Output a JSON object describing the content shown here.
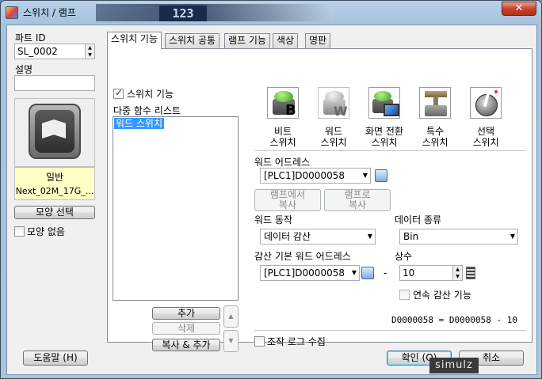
{
  "window": {
    "title": "스위치 / 램프",
    "close_glyph": "✕",
    "bg_number": "123"
  },
  "left": {
    "part_id_label": "파트 ID",
    "part_id_value": "SL_0002",
    "desc_label": "설명",
    "desc_value": "",
    "shape_name": "일반",
    "shape_file": "Next_02M_17G_...",
    "select_shape_btn": "모양 선택",
    "no_shape_label": "모양 없음",
    "no_shape_checked": false
  },
  "tabs": [
    "스위치 기능",
    "스위치 공통",
    "램프 기능",
    "색상",
    "명판"
  ],
  "switch_func": {
    "enable_label": "스위치 기능",
    "enable_checked": true,
    "multi_list_label": "다중 함수 리스트",
    "list_items": [
      "워드 스위치"
    ],
    "add_btn": "추가",
    "delete_btn": "삭제",
    "copy_add_btn": "복사 & 추가",
    "up_glyph": "▲",
    "down_glyph": "▼"
  },
  "func_types": [
    {
      "line1": "비트",
      "line2": "스위치",
      "icon": "bit-switch-icon"
    },
    {
      "line1": "워드",
      "line2": "스위치",
      "icon": "word-switch-icon"
    },
    {
      "line1": "화면 전환",
      "line2": "스위치",
      "icon": "screen-change-switch-icon"
    },
    {
      "line1": "특수",
      "line2": "스위치",
      "icon": "special-switch-icon"
    },
    {
      "line1": "선택",
      "line2": "스위치",
      "icon": "selector-switch-icon"
    }
  ],
  "word": {
    "address_label": "워드 어드레스",
    "address_value": "[PLC1]D0000058",
    "copy_from_lamp": "램프에서\n복사",
    "copy_to_lamp": "램프로\n복사",
    "action_label": "워드 동작",
    "action_value": "데이터 감산",
    "data_type_label": "데이터 종류",
    "data_type_value": "Bin",
    "base_addr_label": "감산 기본 워드 어드레스",
    "base_addr_value": "[PLC1]D0000058",
    "minus": "-",
    "const_label": "상수",
    "const_value": "10",
    "continuous_label": "연속 감산 기능",
    "continuous_checked": false,
    "formula": "D0000058 = D0000058 - 10"
  },
  "log_label": "조작 로그 수집",
  "log_checked": false,
  "footer": {
    "help": "도움말 (H)",
    "ok": "확인 (O)",
    "cancel": "취소"
  },
  "watermark": "simulz"
}
